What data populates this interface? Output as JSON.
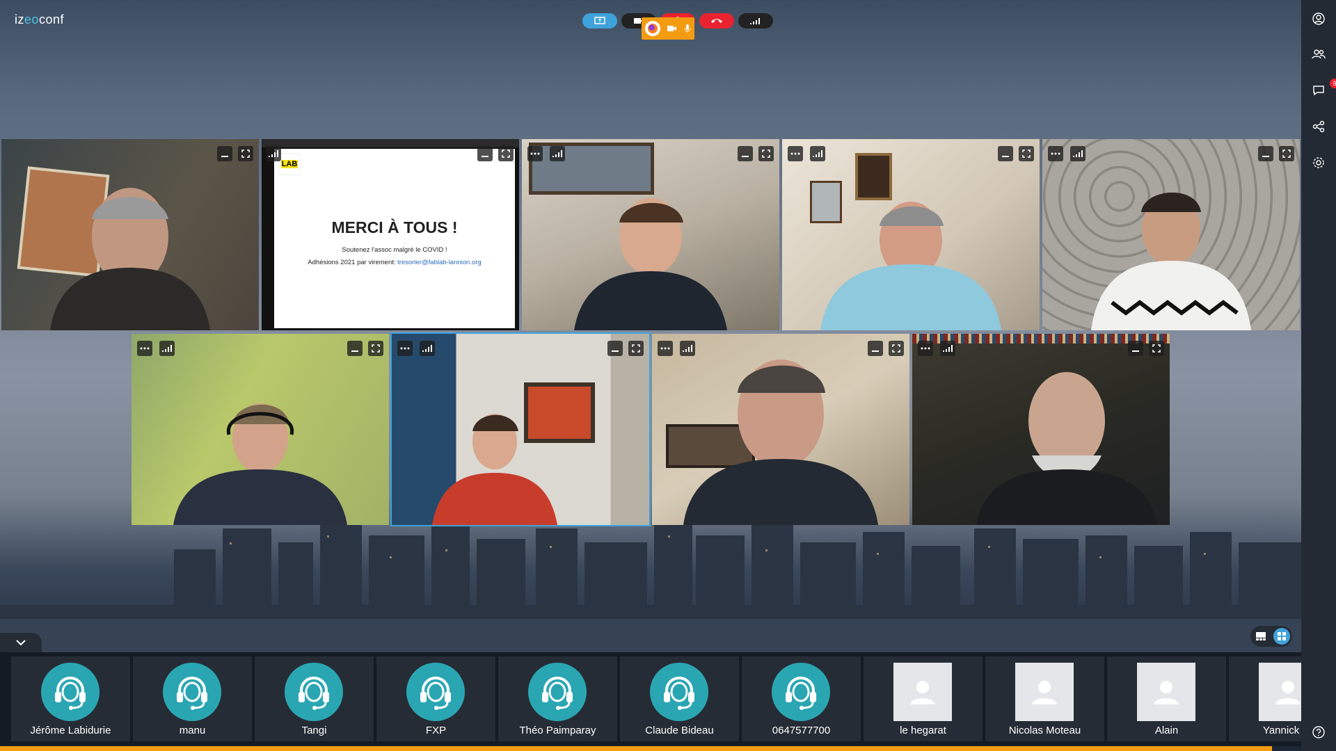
{
  "app": {
    "logo_prefix": "iz",
    "logo_accent": "eo",
    "logo_suffix": "conf"
  },
  "colors": {
    "accent": "#3fa2da",
    "danger": "#e8232f",
    "teal_avatar": "#2aa6b3",
    "notify_orange": "#f39c12"
  },
  "toolbar": {
    "icons": [
      "screen-share-icon",
      "camera-icon",
      "microphone-icon",
      "hangup-icon",
      "network-signal-icon"
    ],
    "overlay_icons": [
      "firefox-icon",
      "camera-active-icon",
      "microphone-active-icon"
    ]
  },
  "sidebar": {
    "icons": [
      "user-icon",
      "participants-icon",
      "chat-icon",
      "share-icon",
      "settings-icon",
      "help-icon"
    ],
    "chat_badge": "9"
  },
  "slide": {
    "title": "MERCI À TOUS !",
    "line1": "Soutenez l'assoc malgré le COVID !",
    "line2_prefix": "Adhésions 2021 par virement: ",
    "line2_link": "tresorier@fablab-lannion.org",
    "logo_text": "LAB"
  },
  "participants": [
    {
      "name": "Jérôme Labidurie",
      "avatar": "headset"
    },
    {
      "name": "manu",
      "avatar": "headset"
    },
    {
      "name": "Tangi",
      "avatar": "headset"
    },
    {
      "name": "FXP",
      "avatar": "headset"
    },
    {
      "name": "Théo Paimparay",
      "avatar": "headset"
    },
    {
      "name": "Claude Bideau",
      "avatar": "headset"
    },
    {
      "name": "0647577700",
      "avatar": "headset"
    },
    {
      "name": "le hegarat",
      "avatar": "person"
    },
    {
      "name": "Nicolas Moteau",
      "avatar": "person"
    },
    {
      "name": "Alain",
      "avatar": "person"
    },
    {
      "name": "Yannick La",
      "avatar": "person"
    }
  ]
}
